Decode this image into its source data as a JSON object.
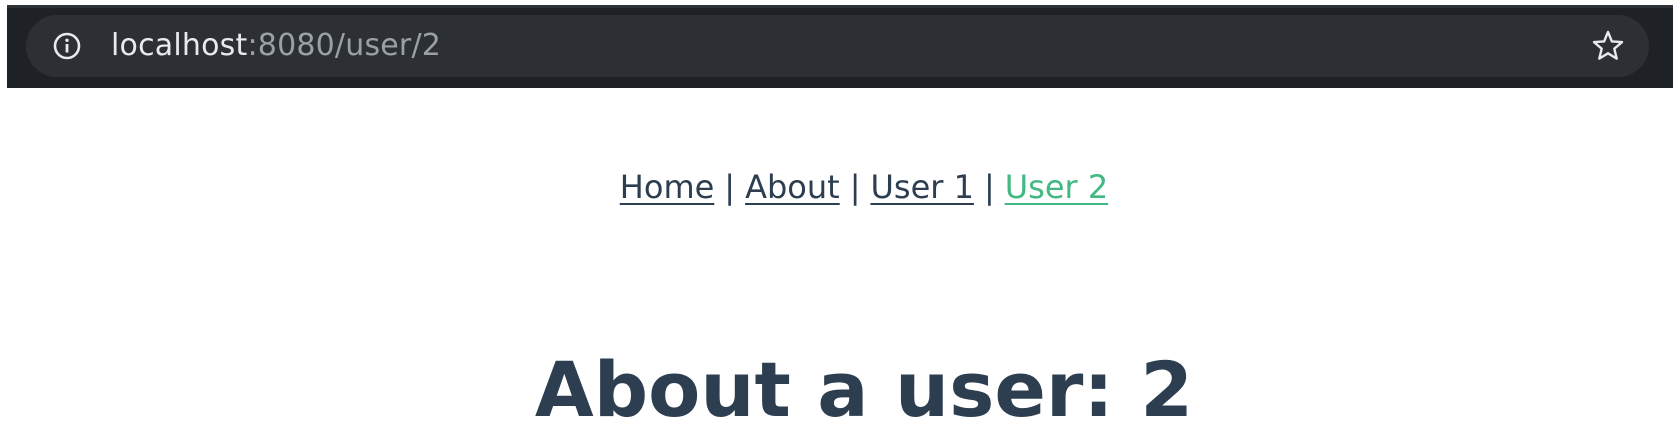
{
  "browser": {
    "url_host": "localhost",
    "url_rest": ":8080/user/2",
    "info_icon": "info-icon",
    "bookmark_icon": "star-icon"
  },
  "nav": {
    "links": [
      {
        "label": "Home",
        "active": false
      },
      {
        "label": "About",
        "active": false
      },
      {
        "label": "User 1",
        "active": false
      },
      {
        "label": "User 2",
        "active": true
      }
    ],
    "separator": "|"
  },
  "main": {
    "heading": "About a user: 2"
  },
  "colors": {
    "text": "#2c3e50",
    "active_link": "#42b983",
    "browser_bar": "#1e2125",
    "address_pill": "#2c3035"
  }
}
